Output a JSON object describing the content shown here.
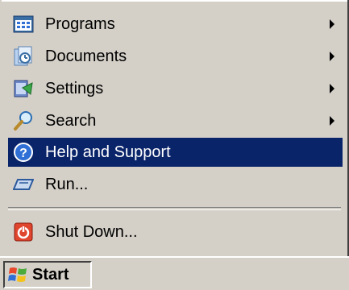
{
  "start_menu": {
    "items": [
      {
        "label": "Programs",
        "icon": "programs-icon",
        "has_submenu": true
      },
      {
        "label": "Documents",
        "icon": "documents-icon",
        "has_submenu": true
      },
      {
        "label": "Settings",
        "icon": "settings-icon",
        "has_submenu": true
      },
      {
        "label": "Search",
        "icon": "search-icon",
        "has_submenu": true
      },
      {
        "label": "Help and Support",
        "icon": "help-icon",
        "has_submenu": false,
        "highlighted": true
      },
      {
        "label": "Run...",
        "icon": "run-icon",
        "has_submenu": false
      }
    ],
    "shutdown": {
      "label": "Shut Down...",
      "icon": "shutdown-icon"
    }
  },
  "taskbar": {
    "start_label": "Start"
  },
  "colors": {
    "face": "#d4d0c8",
    "highlight": "#0a246a",
    "highlight_text": "#ffffff"
  }
}
